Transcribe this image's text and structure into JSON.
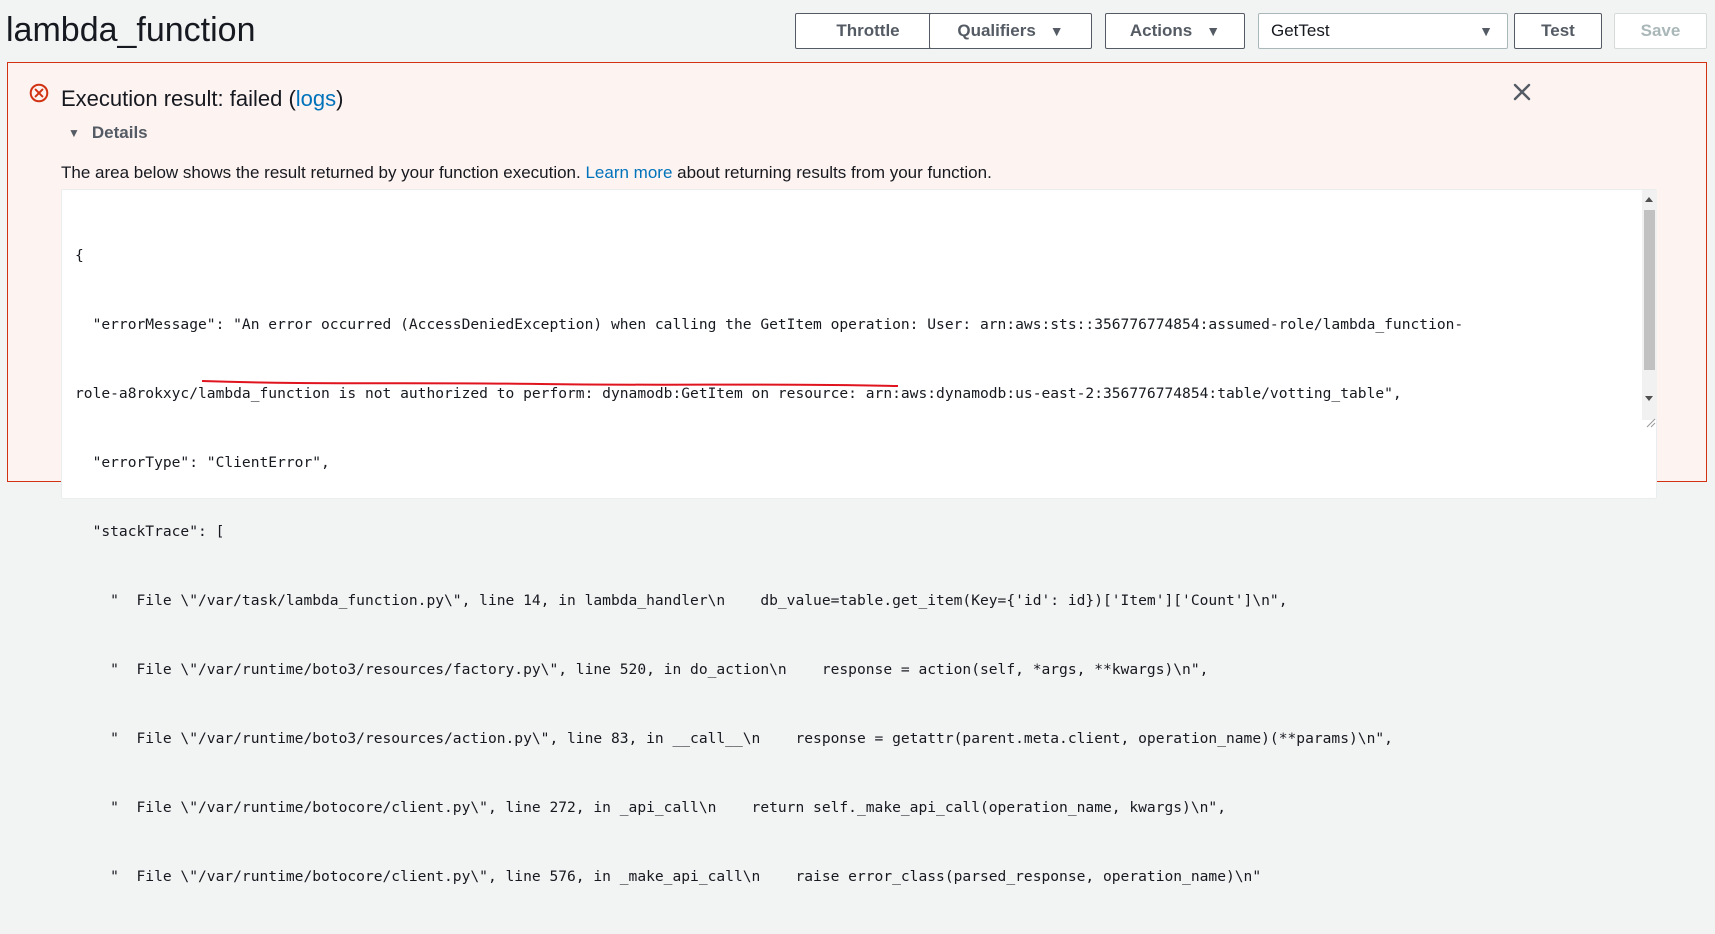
{
  "function_name": "lambda_function",
  "toolbar": {
    "throttle_label": "Throttle",
    "qualifiers_label": "Qualifiers",
    "actions_label": "Actions",
    "test_event_selected": "GetTest",
    "test_label": "Test",
    "save_label": "Save"
  },
  "result": {
    "title_prefix": "Execution result: failed (",
    "logs_link": "logs",
    "title_suffix": ")",
    "details_label": "Details",
    "description_prefix": "The area below shows the result returned by your function execution. ",
    "learn_more_link": "Learn more",
    "description_suffix": " about returning results from your function.",
    "code_lines": [
      "{",
      "  \"errorMessage\": \"An error occurred (AccessDeniedException) when calling the GetItem operation: User: arn:aws:sts::356776774854:assumed-role/lambda_function-",
      "role-a8rokxyc/lambda_function is not authorized to perform: dynamodb:GetItem on resource: arn:aws:dynamodb:us-east-2:356776774854:table/votting_table\",",
      "  \"errorType\": \"ClientError\",",
      "  \"stackTrace\": [",
      "    \"  File \\\"/var/task/lambda_function.py\\\", line 14, in lambda_handler\\n    db_value=table.get_item(Key={'id': id})['Item']['Count']\\n\",",
      "    \"  File \\\"/var/runtime/boto3/resources/factory.py\\\", line 520, in do_action\\n    response = action(self, *args, **kwargs)\\n\",",
      "    \"  File \\\"/var/runtime/boto3/resources/action.py\\\", line 83, in __call__\\n    response = getattr(parent.meta.client, operation_name)(**params)\\n\",",
      "    \"  File \\\"/var/runtime/botocore/client.py\\\", line 272, in _api_call\\n    return self._make_api_call(operation_name, kwargs)\\n\",",
      "    \"  File \\\"/var/runtime/botocore/client.py\\\", line 576, in _make_api_call\\n    raise error_class(parsed_response, operation_name)\\n\""
    ]
  },
  "colors": {
    "error": "#d13212",
    "link": "#0073bb",
    "annotation": "#e0141e"
  },
  "icons": {
    "error": "error-circle-icon",
    "close": "close-icon",
    "caret": "caret-down-icon"
  }
}
